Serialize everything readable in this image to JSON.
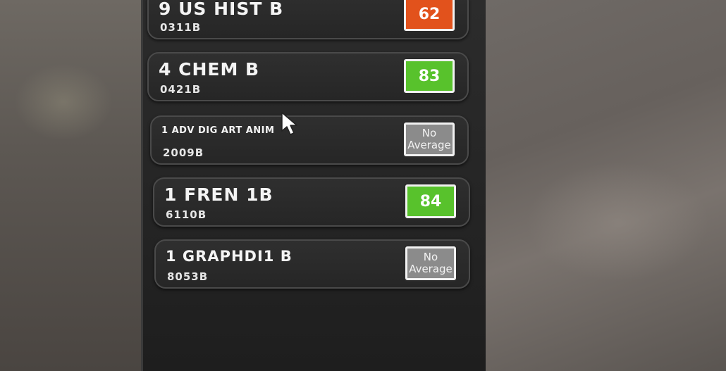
{
  "courses": [
    {
      "name": "9 US HIST B",
      "code": "0311B",
      "grade": "62",
      "status": "red"
    },
    {
      "name": "4 CHEM B",
      "code": "0421B",
      "grade": "83",
      "status": "green"
    },
    {
      "name": "1 ADV DIG ART ANIM",
      "code": "2009B",
      "grade_line1": "No",
      "grade_line2": "Average",
      "status": "none"
    },
    {
      "name": "1 FREN 1B",
      "code": "6110B",
      "grade": "84",
      "status": "green"
    },
    {
      "name": "1 GRAPHDI1 B",
      "code": "8053B",
      "grade_line1": "No",
      "grade_line2": "Average",
      "status": "none"
    }
  ],
  "colors": {
    "grade_green": "#58c22c",
    "grade_red": "#e2521c",
    "no_average_gray": "#8b8b8b",
    "panel_background": "#262626"
  },
  "icons": {
    "cursor": "mouse-pointer-icon"
  }
}
